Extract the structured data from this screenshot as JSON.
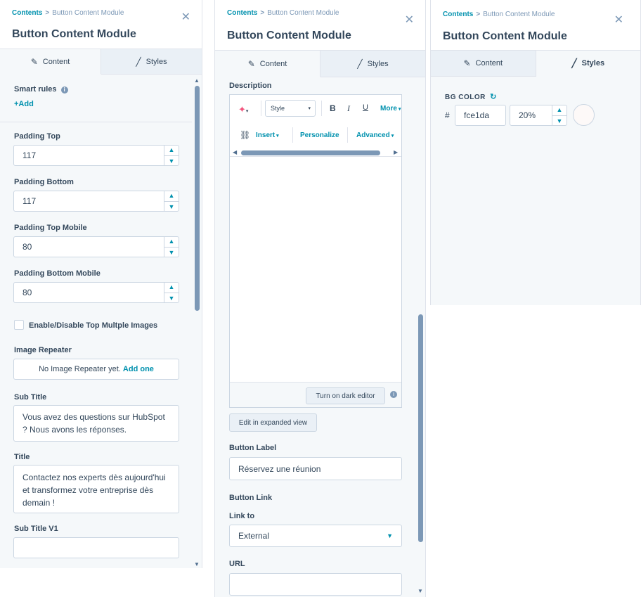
{
  "breadcrumb": {
    "root": "Contents",
    "separator": ">",
    "current": "Button Content Module"
  },
  "module_title": "Button Content Module",
  "tabs": {
    "content": "Content",
    "styles": "Styles"
  },
  "icons": {
    "close": "close-icon",
    "pencil": "pencil-icon",
    "brush": "brush-icon",
    "info": "info-icon",
    "refresh": "refresh-icon"
  },
  "panel1": {
    "smart_rules_label": "Smart rules",
    "add_label": "+Add",
    "padding_top": {
      "label": "Padding Top",
      "value": "117"
    },
    "padding_bottom": {
      "label": "Padding Bottom",
      "value": "117"
    },
    "padding_top_mobile": {
      "label": "Padding Top Mobile",
      "value": "80"
    },
    "padding_bottom_mobile": {
      "label": "Padding Bottom Mobile",
      "value": "80"
    },
    "checkbox_label": "Enable/Disable Top Multple Images",
    "image_repeater": {
      "label": "Image Repeater",
      "empty_text": "No Image Repeater yet.",
      "add_one": "Add one"
    },
    "sub_title": {
      "label": "Sub Title",
      "value": "Vous avez des questions sur HubSpot ? Nous avons les réponses."
    },
    "title": {
      "label": "Title",
      "value": "Contactez nos experts dès aujourd'hui et transformez votre entreprise dès demain !"
    },
    "sub_title_v1": {
      "label": "Sub Title V1",
      "value": ""
    }
  },
  "panel2": {
    "description_label": "Description",
    "toolbar": {
      "style": "Style",
      "bold": "B",
      "italic": "I",
      "underline": "U",
      "more": "More",
      "insert": "Insert",
      "personalize": "Personalize",
      "advanced": "Advanced"
    },
    "dark_editor": "Turn on dark editor",
    "expanded_view": "Edit in expanded view",
    "button_label": {
      "label": "Button Label",
      "value": "Réservez une réunion"
    },
    "button_link_label": "Button Link",
    "link_to": {
      "label": "Link to",
      "value": "External"
    },
    "url": {
      "label": "URL",
      "value": ""
    }
  },
  "panel3": {
    "bg_color_label": "BG COLOR",
    "hash": "#",
    "hex": "fce1da",
    "opacity": "20%",
    "swatch_color": "#fdf9f8"
  }
}
